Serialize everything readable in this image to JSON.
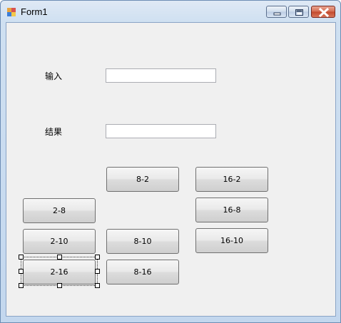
{
  "window": {
    "title": "Form1"
  },
  "form": {
    "input_label": "输入",
    "result_label": "结果",
    "input_value": "",
    "result_value": ""
  },
  "buttons": {
    "b8_2": "8-2",
    "b16_2": "16-2",
    "b2_8": "2-8",
    "b16_8": "16-8",
    "b2_10": "2-10",
    "b8_10": "8-10",
    "b16_10": "16-10",
    "b2_16": "2-16",
    "b8_16": "8-16"
  },
  "icons": {
    "app": "form-app-icon",
    "minimize": "minimize-icon",
    "maximize": "maximize-icon",
    "close": "close-icon"
  },
  "colors": {
    "close_button": "#c2482c",
    "client_background": "#f0f0f0"
  }
}
